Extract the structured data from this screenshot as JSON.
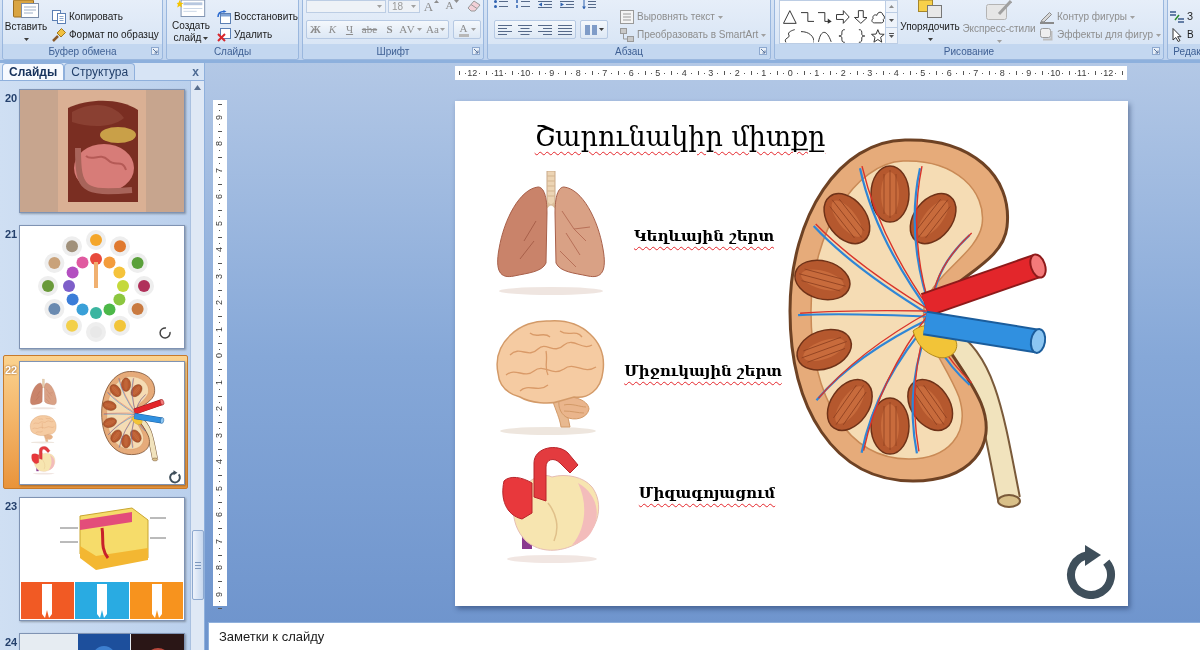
{
  "ribbon": {
    "clipboard": {
      "label": "Буфер обмена",
      "launcher": true,
      "paste": {
        "label": "Вставить",
        "dropdown": true,
        "disabled": false
      },
      "commands": [
        {
          "label": "Копировать",
          "dropdown": false,
          "disabled": false
        },
        {
          "label": "Формат по образцу",
          "dropdown": false,
          "disabled": false
        }
      ]
    },
    "slides": {
      "label": "Слайды",
      "new_slide": {
        "label": "Создать слайд",
        "dropdown": true,
        "disabled": false
      },
      "commands": [
        {
          "label": "Восстановить",
          "dropdown": false,
          "disabled": false
        },
        {
          "label": "Удалить",
          "dropdown": false,
          "disabled": false
        }
      ]
    },
    "font": {
      "label": "Шрифт",
      "launcher": true,
      "disabled": true,
      "size": "18",
      "grow_shrink": [
        "A",
        "A"
      ],
      "format_buttons": [
        {
          "label": "Ж",
          "dropdown": false
        },
        {
          "label": "К",
          "dropdown": false
        },
        {
          "label": "Ч",
          "dropdown": false
        },
        {
          "label": "abe",
          "dropdown": false
        },
        {
          "label": "S",
          "dropdown": false
        },
        {
          "label": "AV",
          "dropdown": true
        },
        {
          "label": "Aa",
          "dropdown": true
        }
      ],
      "font_color": "A"
    },
    "paragraph": {
      "label": "Абзац",
      "launcher": true,
      "commands": [
        {
          "label": "Выровнять текст",
          "dropdown": true,
          "disabled": true
        },
        {
          "label": "Преобразовать в SmartArt",
          "dropdown": true,
          "disabled": true
        }
      ]
    },
    "drawing": {
      "label": "Рисование",
      "launcher": true,
      "arrange": {
        "label": "Упорядочить",
        "dropdown": true,
        "disabled": false
      },
      "quick_styles": {
        "label": "Экспресс-стили",
        "dropdown": true,
        "disabled": true
      },
      "commands": [
        {
          "label": "Контур фигуры",
          "dropdown": true,
          "disabled": true
        },
        {
          "label": "Эффекты для фигур",
          "dropdown": true,
          "disabled": true
        }
      ]
    },
    "editing": {
      "label": "Редак",
      "commands": [
        {
          "label": "З",
          "dropdown": false,
          "disabled": false
        },
        {
          "label": "В",
          "dropdown": false,
          "disabled": false
        }
      ]
    }
  },
  "slide_panel": {
    "tabs": [
      {
        "label": "Слайды",
        "selected": true
      },
      {
        "label": "Структура",
        "selected": false
      }
    ],
    "close": "x",
    "slides": [
      {
        "number": "20",
        "kind": "photo",
        "selected": false
      },
      {
        "number": "21",
        "kind": "vitamins",
        "selected": false
      },
      {
        "number": "22",
        "kind": "organs",
        "selected": true
      },
      {
        "number": "23",
        "kind": "skin",
        "selected": false
      },
      {
        "number": "24",
        "kind": "photos",
        "selected": false
      }
    ]
  },
  "rulers": {
    "horizontal": [
      "12",
      "11",
      "10",
      "9",
      "8",
      "7",
      "6",
      "5",
      "4",
      "3",
      "2",
      "1",
      "0",
      "1",
      "2",
      "3",
      "4",
      "5",
      "6",
      "7",
      "8",
      "9",
      "10",
      "11",
      "12"
    ],
    "vertical": [
      "9",
      "8",
      "7",
      "6",
      "5",
      "4",
      "3",
      "2",
      "1",
      "0",
      "1",
      "2",
      "3",
      "4",
      "5",
      "6",
      "7",
      "8",
      "9"
    ]
  },
  "slide": {
    "title": {
      "text": "Շարունակիր միտքը",
      "misspelled": true
    },
    "labels": [
      {
        "text": "Կեղևային շերտ",
        "misspelled": true
      },
      {
        "text": "Միջուկային շերտ",
        "misspelled": true
      },
      {
        "text": "Միզագոյացում",
        "misspelled": true
      }
    ]
  },
  "notes": {
    "placeholder": "Заметки к слайду"
  }
}
